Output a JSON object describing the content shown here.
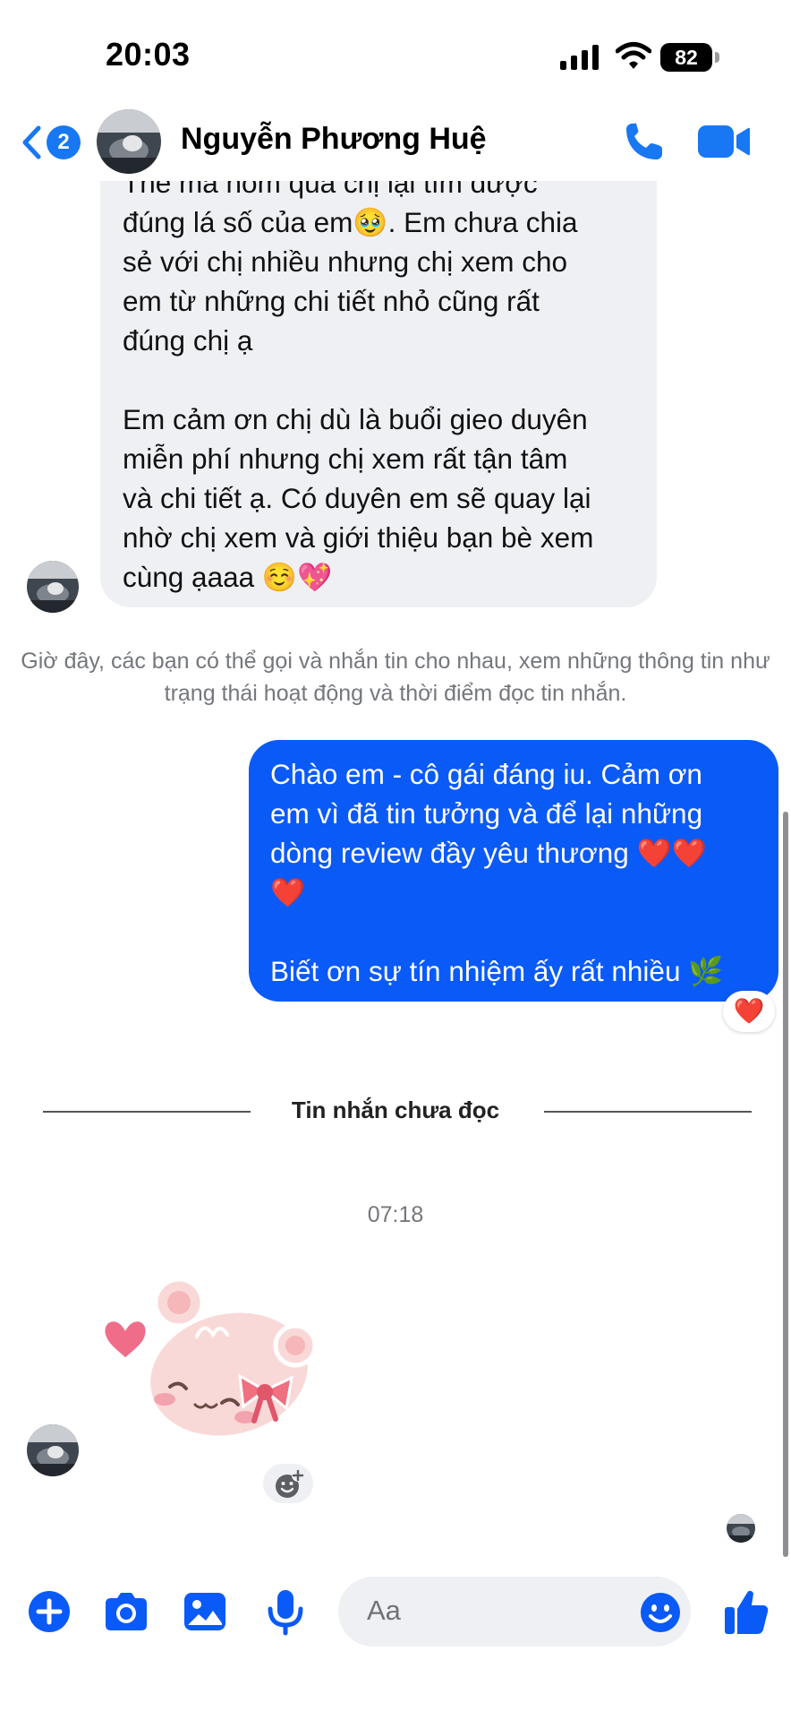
{
  "status_bar": {
    "time": "20:03",
    "battery_level": "82",
    "icons": [
      "cellular-signal-icon",
      "wifi-icon",
      "battery-icon"
    ]
  },
  "header": {
    "back_count": "2",
    "contact_name": "Nguyễn Phương Huệ",
    "icons": [
      "back-chevron-icon",
      "phone-icon",
      "video-camera-icon"
    ]
  },
  "messages": {
    "incoming_text": "Thế mà hôm qua chị lại tìm được\nđúng lá số của em🥹. Em chưa chia\nsẻ với chị nhiều nhưng chị xem cho\nem từ những chi tiết nhỏ cũng rất\nđúng chị ạ\n\nEm cảm ơn chị dù là buổi gieo duyên\nmiễn phí nhưng chị xem rất tận tâm\nvà chi tiết ạ. Có duyên em sẽ quay lại\nnhờ chị xem và giới thiệu bạn bè xem\ncùng ạaaa ☺️💖",
    "system_notice": "Giờ đây, các bạn có thể gọi và nhắn tin cho nhau, xem những thông tin như trạng thái hoạt động và thời điểm đọc tin nhắn.",
    "outgoing_text": "Chào em - cô gái đáng iu. Cảm ơn\nem vì đã tin tưởng và để lại những\ndòng review đầy yêu thương ❤️❤️\n❤️\n\nBiết ơn sự tín nhiệm ấy rất nhiều 🌿",
    "outgoing_reaction": "❤️",
    "unread_divider": "Tin nhắn chưa đọc",
    "timestamp": "07:18",
    "sticker": "pink-bear-heart-sticker"
  },
  "composer": {
    "placeholder": "Aa",
    "icons": [
      "plus-icon",
      "camera-icon",
      "image-icon",
      "microphone-icon",
      "emoji-icon",
      "thumbs-up-icon"
    ]
  },
  "colors": {
    "accent": "#0a5af8",
    "messenger_blue": "#1877f2",
    "incoming_bubble": "#eff0f4",
    "muted_text": "#74777c"
  }
}
